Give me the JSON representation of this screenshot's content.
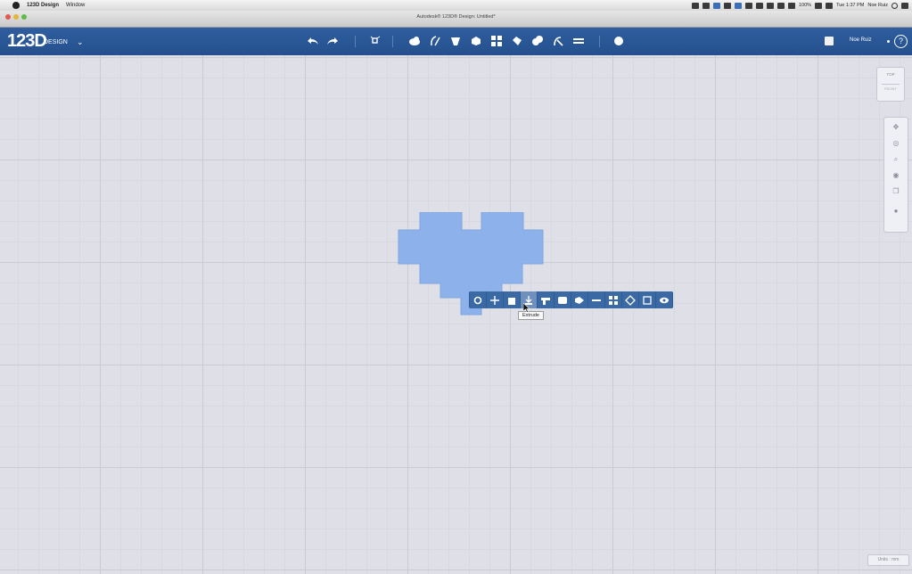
{
  "menubar": {
    "app_name": "123D Design",
    "menus": [
      "Window"
    ],
    "battery": "100%",
    "clock": "Tue 1:37 PM",
    "user": "Noe Ruiz"
  },
  "window": {
    "title": "Autodesk® 123D® Design: Untitled*"
  },
  "toolbar": {
    "logo": "123D",
    "logo_sub": "DESIGN",
    "user": "Noe Ruiz",
    "help": "?"
  },
  "viewcube": {
    "face": "TOP",
    "sub": "FRONT"
  },
  "context_toolbar": {
    "tooltip": "Extrude"
  },
  "status": {
    "units": "Units : mm"
  },
  "colors": {
    "toolbar_blue": "#2a5896",
    "shape_fill": "#8db1ea",
    "canvas_bg": "#dfe0e7"
  }
}
